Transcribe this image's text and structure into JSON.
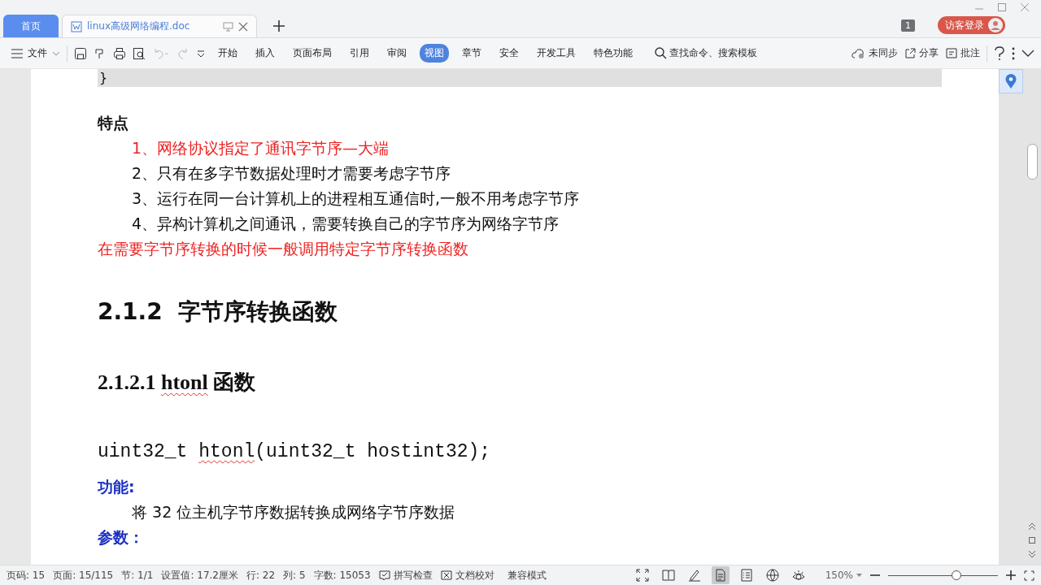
{
  "tabs": [
    {
      "label": "首页",
      "kind": "home",
      "selected": false
    },
    {
      "label": "linux高级网络编程.doc",
      "kind": "doc",
      "selected": true
    }
  ],
  "header": {
    "page_badge": "1",
    "login_button": "访客登录"
  },
  "toolbar": {
    "file_menu": "文件",
    "ribbon_tabs": [
      {
        "label": "开始",
        "selected": false
      },
      {
        "label": "插入",
        "selected": false
      },
      {
        "label": "页面布局",
        "selected": false
      },
      {
        "label": "引用",
        "selected": false
      },
      {
        "label": "审阅",
        "selected": false
      },
      {
        "label": "视图",
        "selected": true
      },
      {
        "label": "章节",
        "selected": false
      },
      {
        "label": "安全",
        "selected": false
      },
      {
        "label": "开发工具",
        "selected": false
      },
      {
        "label": "特色功能",
        "selected": false
      }
    ],
    "search": "查找命令、搜索模板",
    "sync": "未同步",
    "share": "分享",
    "comment": "批注"
  },
  "document": [
    {
      "kind": "code_end",
      "text": "}"
    },
    {
      "kind": "label",
      "text": "特点"
    },
    {
      "kind": "list_item",
      "text": "1、网络协议指定了通讯字节序—大端",
      "color": "#ee2222"
    },
    {
      "kind": "list_item",
      "text": "2、只有在多字节数据处理时才需要考虑字节序",
      "color": "#111111"
    },
    {
      "kind": "list_item",
      "text": "3、运行在同一台计算机上的进程相互通信时,一般不用考虑字节序",
      "color": "#111111"
    },
    {
      "kind": "list_item",
      "text": "4、异构计算机之间通讯，需要转换自己的字节序为网络字节序",
      "color": "#111111"
    },
    {
      "kind": "paragraph",
      "text": "在需要字节序转换的时候一般调用特定字节序转换函数",
      "color": "#ee2222"
    },
    {
      "kind": "heading2",
      "parts": [
        {
          "text": "2.1.2  字节序转换函数",
          "misspelled": false
        }
      ]
    },
    {
      "kind": "heading3",
      "parts": [
        {
          "text": "2.1.2.1 ",
          "misspelled": false
        },
        {
          "text": "htonl",
          "misspelled": true
        },
        {
          "text": " 函数",
          "misspelled": false
        }
      ]
    },
    {
      "kind": "code",
      "parts": [
        {
          "text": "uint32_t ",
          "misspelled": false
        },
        {
          "text": "htonl",
          "misspelled": true
        },
        {
          "text": "(uint32_t hostint32);",
          "misspelled": false
        }
      ]
    },
    {
      "kind": "blue_label",
      "text": "功能:"
    },
    {
      "kind": "indent_text",
      "text": "将 32 位主机字节序数据转换成网络字节序数据"
    },
    {
      "kind": "blue_label",
      "text": "参数："
    }
  ],
  "status_bar": {
    "items": [
      "页码: 15",
      "页面: 15/115",
      "节: 1/1",
      "设置值: 17.2厘米",
      "行: 22",
      "列: 5",
      "字数: 15053"
    ],
    "spell_check": "拼写检查",
    "proofing": "文档校对",
    "mode": "兼容模式",
    "views": [
      {
        "kind": "fullscreen",
        "selected": false
      },
      {
        "kind": "reading",
        "selected": false
      },
      {
        "kind": "pen",
        "selected": false
      },
      {
        "kind": "page",
        "selected": true
      },
      {
        "kind": "outline",
        "selected": false
      },
      {
        "kind": "web",
        "selected": false
      },
      {
        "kind": "eye",
        "selected": false
      }
    ],
    "zoom": "150%",
    "zoom_level": {
      "level": 0.62
    }
  }
}
